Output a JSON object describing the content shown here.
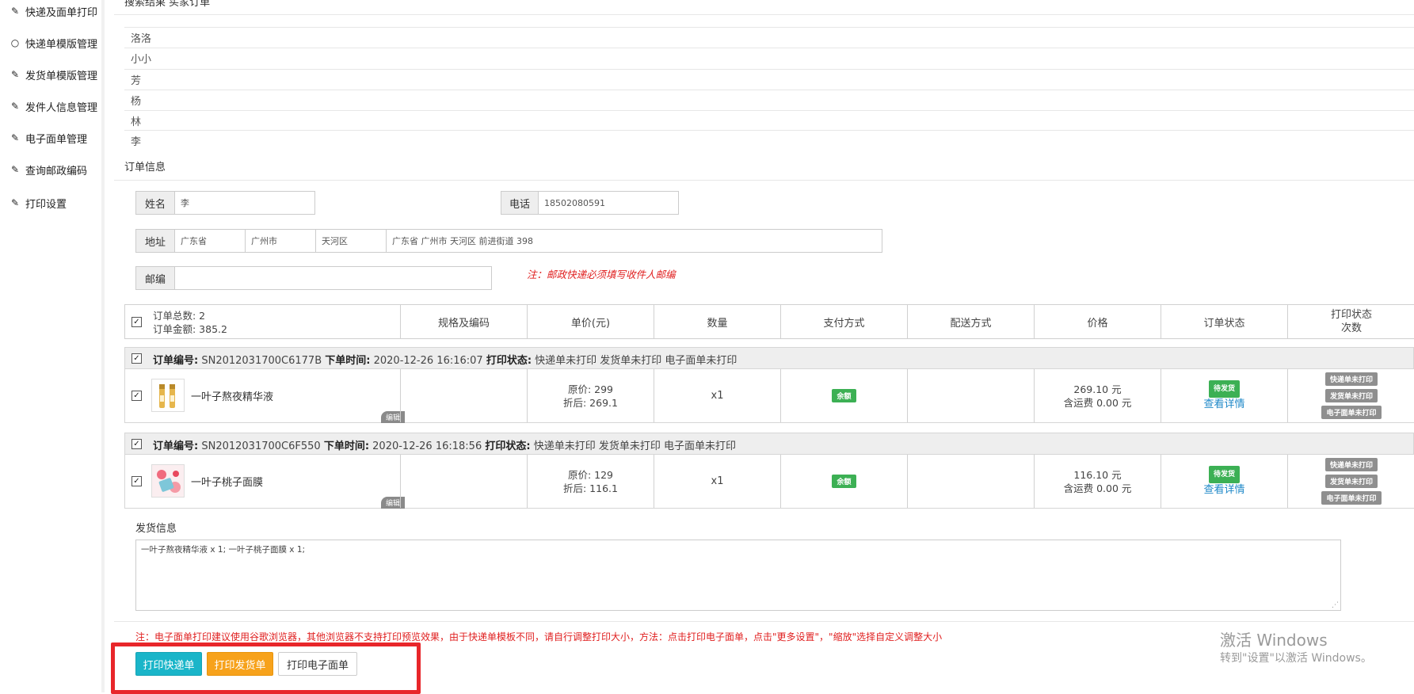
{
  "sidebar": {
    "items": [
      {
        "label": "快递及面单打印",
        "icon": "magic-wand-icon",
        "glyph": "✎"
      },
      {
        "label": "快递单模版管理",
        "icon": "circle-icon",
        "glyph": "○"
      },
      {
        "label": "发货单模版管理",
        "icon": "edit-icon",
        "glyph": "✎"
      },
      {
        "label": "发件人信息管理",
        "icon": "edit-icon",
        "glyph": "✎"
      },
      {
        "label": "电子面单管理",
        "icon": "edit-icon",
        "glyph": "✎"
      },
      {
        "label": "查询邮政编码",
        "icon": "edit-icon",
        "glyph": "✎"
      },
      {
        "label": "打印设置",
        "icon": "edit-icon",
        "glyph": "✎"
      }
    ]
  },
  "main": {
    "search_result_title": "搜索结果 买家订单",
    "recipients": [
      "洛洛",
      "小小",
      "芳",
      "杨",
      "林",
      "李"
    ],
    "order_info_title": "订单信息",
    "form": {
      "name_label": "姓名",
      "name_value": "李",
      "phone_label": "电话",
      "phone_value": "18502080591",
      "address_label": "地址",
      "province": "广东省",
      "city": "广州市",
      "district": "天河区",
      "address_detail": "广东省 广州市 天河区 前进街道 398",
      "zip_label": "邮编",
      "zip_value": "",
      "zip_note": "注：邮政快递必须填写收件人邮编"
    },
    "table": {
      "summary_count": "订单总数: 2",
      "summary_amount": "订单金额: 385.2",
      "headers": [
        "规格及编码",
        "单价(元)",
        "数量",
        "支付方式",
        "配送方式",
        "价格",
        "订单状态"
      ],
      "print_status_header_line1": "打印状态",
      "print_status_header_line2": "次数",
      "orders": [
        {
          "no_label": "订单编号:",
          "no": "SN2012031700C6177B",
          "time_label": "下单时间:",
          "time": "2020-12-26 16:16:07",
          "print_label": "打印状态:",
          "print_status": "快递单未打印 发货单未打印 电子面单未打印",
          "product": "一叶子熬夜精华液",
          "edit": "编辑",
          "orig_price": "原价: 299",
          "disc_price": "折后: 269.1",
          "qty": "x1",
          "pay": "余额",
          "total": "269.10 元",
          "shipping": "含运费 0.00 元",
          "status": "待发货",
          "detail": "查看详情",
          "print_badges": [
            "快递单未打印",
            "发货单未打印",
            "电子面单未打印"
          ]
        },
        {
          "no_label": "订单编号:",
          "no": "SN2012031700C6F550",
          "time_label": "下单时间:",
          "time": "2020-12-26 16:18:56",
          "print_label": "打印状态:",
          "print_status": "快递单未打印 发货单未打印 电子面单未打印",
          "product": "一叶子桃子面膜",
          "edit": "编辑",
          "orig_price": "原价: 129",
          "disc_price": "折后: 116.1",
          "qty": "x1",
          "pay": "余额",
          "total": "116.10 元",
          "shipping": "含运费 0.00 元",
          "status": "待发货",
          "detail": "查看详情",
          "print_badges": [
            "快递单未打印",
            "发货单未打印",
            "电子面单未打印"
          ]
        }
      ]
    },
    "shipping_info_title": "发货信息",
    "shipping_info_text": "一叶子熬夜精华液 x 1; 一叶子桃子面膜 x 1;",
    "bottom_note": "注：电子面单打印建议使用谷歌浏览器，其他浏览器不支持打印预览效果，由于快递单模板不同，请自行调整打印大小，方法：点击打印电子面单，点击\"更多设置\"，\"缩放\"选择自定义调整大小",
    "buttons": {
      "print_express": "打印快递单",
      "print_delivery": "打印发货单",
      "print_e_waybill": "打印电子面单"
    },
    "watermark_line1": "激活 Windows",
    "watermark_line2": "转到\"设置\"以激活 Windows。"
  },
  "colors": {
    "accent_cyan": "#1ab5c9",
    "accent_orange": "#f7a21b",
    "status_green": "#3cb054",
    "note_red": "#e02020",
    "highlight_red": "#e8262a"
  }
}
